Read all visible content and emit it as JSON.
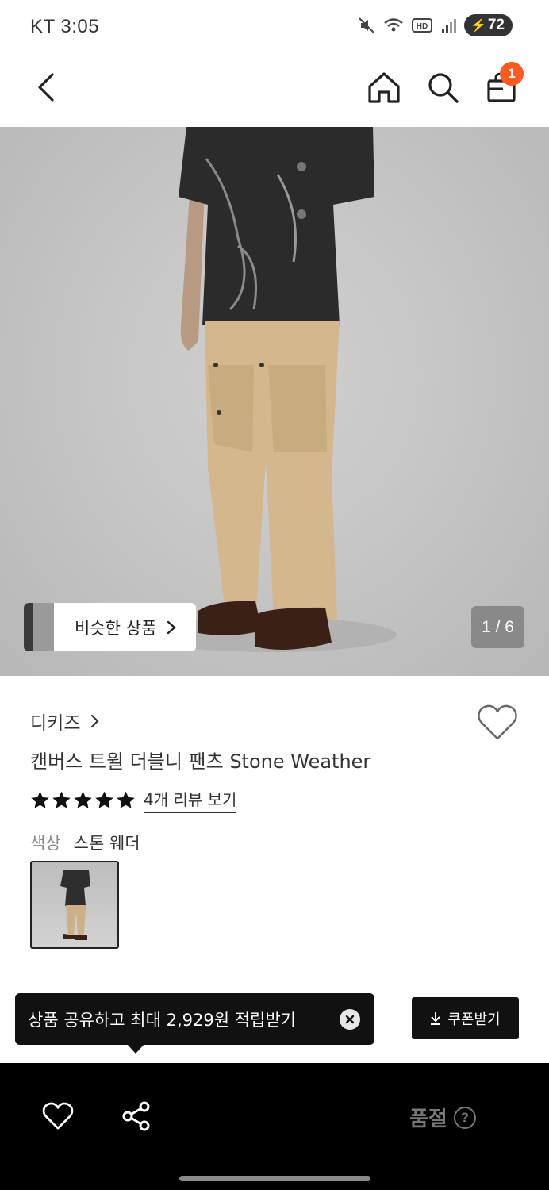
{
  "status_bar": {
    "carrier_time": "KT 3:05",
    "battery": "72"
  },
  "nav": {
    "cart_count": "1"
  },
  "hero": {
    "similar_products_label": "비슷한 상품",
    "image_counter": "1 / 6"
  },
  "product": {
    "brand": "디키즈",
    "name": "캔버스 트윌 더블니 팬츠 Stone Weather",
    "rating_stars": 5,
    "review_link": "4개 리뷰 보기",
    "color_label": "색상",
    "color_value": "스톤 웨더"
  },
  "share_tooltip": {
    "text": "상품 공유하고 최대 2,929원 적립받기"
  },
  "coupon": {
    "label": "쿠폰받기"
  },
  "bottom_bar": {
    "soldout_label": "품절",
    "help_symbol": "?"
  },
  "colors": {
    "accent_badge": "#ff5a1f",
    "dark": "#111111",
    "soldout_text": "#777777"
  }
}
